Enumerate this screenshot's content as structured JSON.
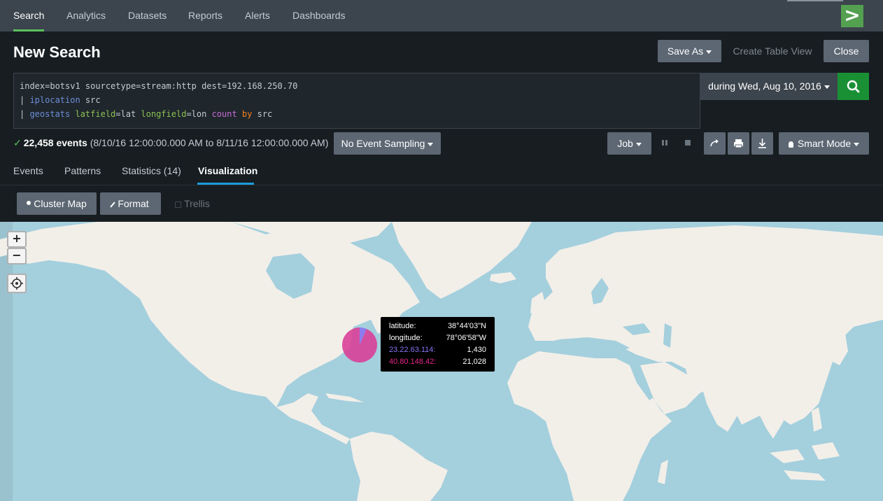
{
  "nav": {
    "tabs": [
      {
        "label": "Search",
        "active": true
      },
      {
        "label": "Analytics"
      },
      {
        "label": "Datasets"
      },
      {
        "label": "Reports"
      },
      {
        "label": "Alerts"
      },
      {
        "label": "Dashboards"
      }
    ],
    "logo_glyph": ">"
  },
  "header": {
    "title": "New Search",
    "save_as": "Save As",
    "create_table_view": "Create Table View",
    "close": "Close"
  },
  "search": {
    "line1": "index=botsv1 sourcetype=stream:http dest=192.168.250.70",
    "line2_pipe": "| ",
    "line2_cmd": "iplocation",
    "line2_rest": " src",
    "line3_pipe": "| ",
    "line3_cmd": "geostats",
    "line3_arg1": "latfield",
    "line3_val1": "=lat ",
    "line3_arg2": "longfield",
    "line3_val2": "=lon ",
    "line3_fn": "count",
    "line3_by": "by",
    "line3_field": " src",
    "time_range": "during Wed, Aug 10, 2016"
  },
  "status": {
    "event_count": "22,458 events",
    "range": "(8/10/16 12:00:00.000 AM to 8/11/16 12:00:00.000 AM)",
    "sampling": "No Event Sampling",
    "job": "Job",
    "mode": "Smart Mode"
  },
  "result_tabs": [
    {
      "label": "Events"
    },
    {
      "label": "Patterns"
    },
    {
      "label": "Statistics (14)"
    },
    {
      "label": "Visualization",
      "active": true
    }
  ],
  "viz_toolbar": {
    "cluster_map": "Cluster Map",
    "format": "Format",
    "trellis": "Trellis"
  },
  "map": {
    "zoom_in": "+",
    "zoom_out": "−",
    "marker_series": [
      {
        "name": "23.22.63.114",
        "count": 1430,
        "color": "#8a72f2"
      },
      {
        "name": "40.80.148.42",
        "count": 21028,
        "color": "#d93f98"
      }
    ],
    "tooltip": {
      "latitude_label": "latitude:",
      "latitude_value": "38°44'03\"N",
      "longitude_label": "longitude:",
      "longitude_value": "78°06'58\"W",
      "src1_label": "23.22.63.114:",
      "src1_value": "1,430",
      "src2_label": "40.80.148.42:",
      "src2_value": "21,028"
    }
  },
  "colors": {
    "accent_green": "#5cc05c",
    "search_button": "#1a9035",
    "tab_underline": "#1a9cda",
    "water": "#a4cfdd",
    "land": "#f2efe9"
  }
}
